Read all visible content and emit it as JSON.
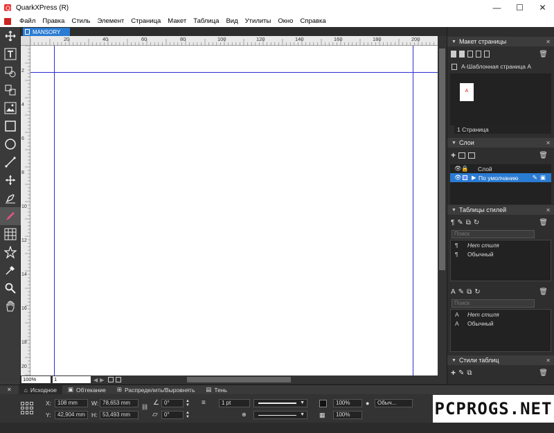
{
  "window": {
    "title": "QuarkXPress (R)",
    "controls": {
      "minimize": "—",
      "maximize": "☐",
      "close": "✕"
    }
  },
  "menu": [
    "Файл",
    "Правка",
    "Стиль",
    "Элемент",
    "Страница",
    "Макет",
    "Таблица",
    "Вид",
    "Утилиты",
    "Окно",
    "Справка"
  ],
  "tools": [
    "move-icon",
    "text-icon",
    "text-link-icon",
    "unlink-icon",
    "picture-box-icon",
    "rectangle-icon",
    "oval-icon",
    "line-icon",
    "pan-icon",
    "pen-icon",
    "pencil-icon",
    "table-icon",
    "star-icon",
    "eyedropper-icon",
    "zoom-icon",
    "hand-icon"
  ],
  "document": {
    "tab": "MANSORY"
  },
  "ruler": {
    "h_ticks": [
      "20",
      "40",
      "60",
      "80",
      "100",
      "120",
      "140",
      "160",
      "180",
      "200"
    ],
    "v_ticks": [
      "2",
      "4",
      "6",
      "8",
      "10",
      "12",
      "14",
      "16",
      "18",
      "20"
    ]
  },
  "navigation": {
    "zoom": "100%",
    "page": "1"
  },
  "panels": {
    "page_layout": {
      "title": "Макет страницы",
      "master": "А-Шаблонная страница А",
      "thumb_label": "A",
      "footer": "1 Страница"
    },
    "layers": {
      "title": "Слои",
      "header": "Слой",
      "default_layer": "По умолчанию"
    },
    "style_sheets": {
      "title": "Таблицы стилей",
      "search_placeholder": "Поиск",
      "para_items": [
        "Нет стиля",
        "Обычный"
      ],
      "char_items": [
        "Нет стиля",
        "Обычный"
      ]
    },
    "table_styles": {
      "title": "Стили таблиц"
    }
  },
  "props": {
    "tabs": [
      "Исходное",
      "Обтекание",
      "Распределить/Выровнять",
      "Тень"
    ],
    "x": "108 mm",
    "y": "42,904 mm",
    "w": "78,653 mm",
    "h": "53,493 mm",
    "angle": "0°",
    "skew": "0°",
    "stroke_width": "1 pt",
    "opacity1": "100%",
    "opacity2": "100%",
    "blend": "Обыч...",
    "labels": {
      "x": "X:",
      "y": "Y:",
      "w": "W:",
      "h": "H:"
    }
  },
  "watermark": "PCPROGS.NET",
  "colors": {
    "accent": "#2a7bd2",
    "margin_guide": "#2c2ccf",
    "dark": "#2e2e2e"
  }
}
